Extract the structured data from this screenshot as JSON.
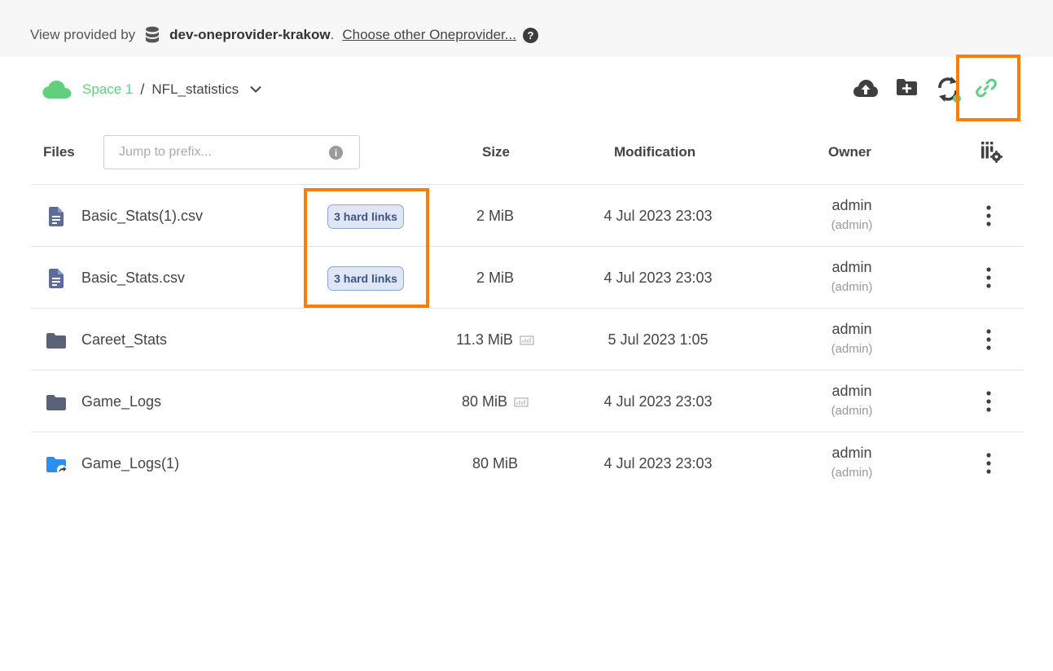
{
  "provider_bar": {
    "prefix": "View provided by",
    "provider_name": "dev-oneprovider-krakow",
    "separator": ".",
    "choose_other": "Choose other Oneprovider...",
    "help": "?"
  },
  "breadcrumb": {
    "space": "Space 1",
    "separator": "/",
    "directory": "NFL_statistics"
  },
  "toolbar": {
    "icons": [
      "upload-icon",
      "new-directory-icon",
      "sync-icon",
      "hard-link-icon"
    ]
  },
  "table": {
    "headers": {
      "files": "Files",
      "size": "Size",
      "modification": "Modification",
      "owner": "Owner"
    },
    "prefix_placeholder": "Jump to prefix...",
    "prefix_info": "i",
    "rows": [
      {
        "name": "Basic_Stats(1).csv",
        "type": "file",
        "badge": "3 hard links",
        "size": "2 MiB",
        "modified": "4 Jul 2023 23:03",
        "owner": "admin",
        "owner_sub": "(admin)"
      },
      {
        "name": "Basic_Stats.csv",
        "type": "file",
        "badge": "3 hard links",
        "size": "2 MiB",
        "modified": "4 Jul 2023 23:03",
        "owner": "admin",
        "owner_sub": "(admin)"
      },
      {
        "name": "Careet_Stats",
        "type": "folder",
        "badge": "",
        "size": "11.3 MiB",
        "modified": "5 Jul 2023 1:05",
        "owner": "admin",
        "owner_sub": "(admin)"
      },
      {
        "name": "Game_Logs",
        "type": "folder",
        "badge": "",
        "size": "80 MiB",
        "modified": "4 Jul 2023 23:03",
        "owner": "admin",
        "owner_sub": "(admin)"
      },
      {
        "name": "Game_Logs(1)",
        "type": "folder-link",
        "badge": "",
        "size": "80 MiB",
        "modified": "4 Jul 2023 23:03",
        "owner": "admin",
        "owner_sub": "(admin)"
      }
    ]
  },
  "colors": {
    "accent_green": "#5fcf7e",
    "highlight_orange": "#ff7d00",
    "file_icon": "#5b6b9a",
    "folder_icon": "#5a6278",
    "folder_link_icon": "#2b8ef0",
    "badge_bg": "#dfe6f6"
  }
}
